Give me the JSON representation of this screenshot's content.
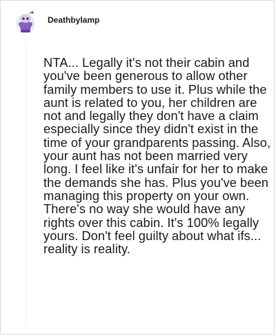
{
  "comment": {
    "username": "Deathbylamp",
    "avatar_icon": "snoo-avatar-icon",
    "body": "NTA... Legally it's not their cabin and you've been generous to allow other family members to use it. Plus while the aunt is related to you, her children are not and legally they don't have a claim especially since they didn't exist in the time of your grandparents passing. Also, your aunt has not been married very long. I feel like it's unfair for her to make the demands she has. Plus you've been managing this property on your own. There's no way she would have any rights over this cabin. It's 100% legally yours. Don't feel guilty about what ifs... reality is reality."
  },
  "colors": {
    "avatar_bg": "#ece9f7",
    "avatar_body": "#8b5fbf",
    "text": "#1a1a1b",
    "border": "#d9d9d9"
  }
}
